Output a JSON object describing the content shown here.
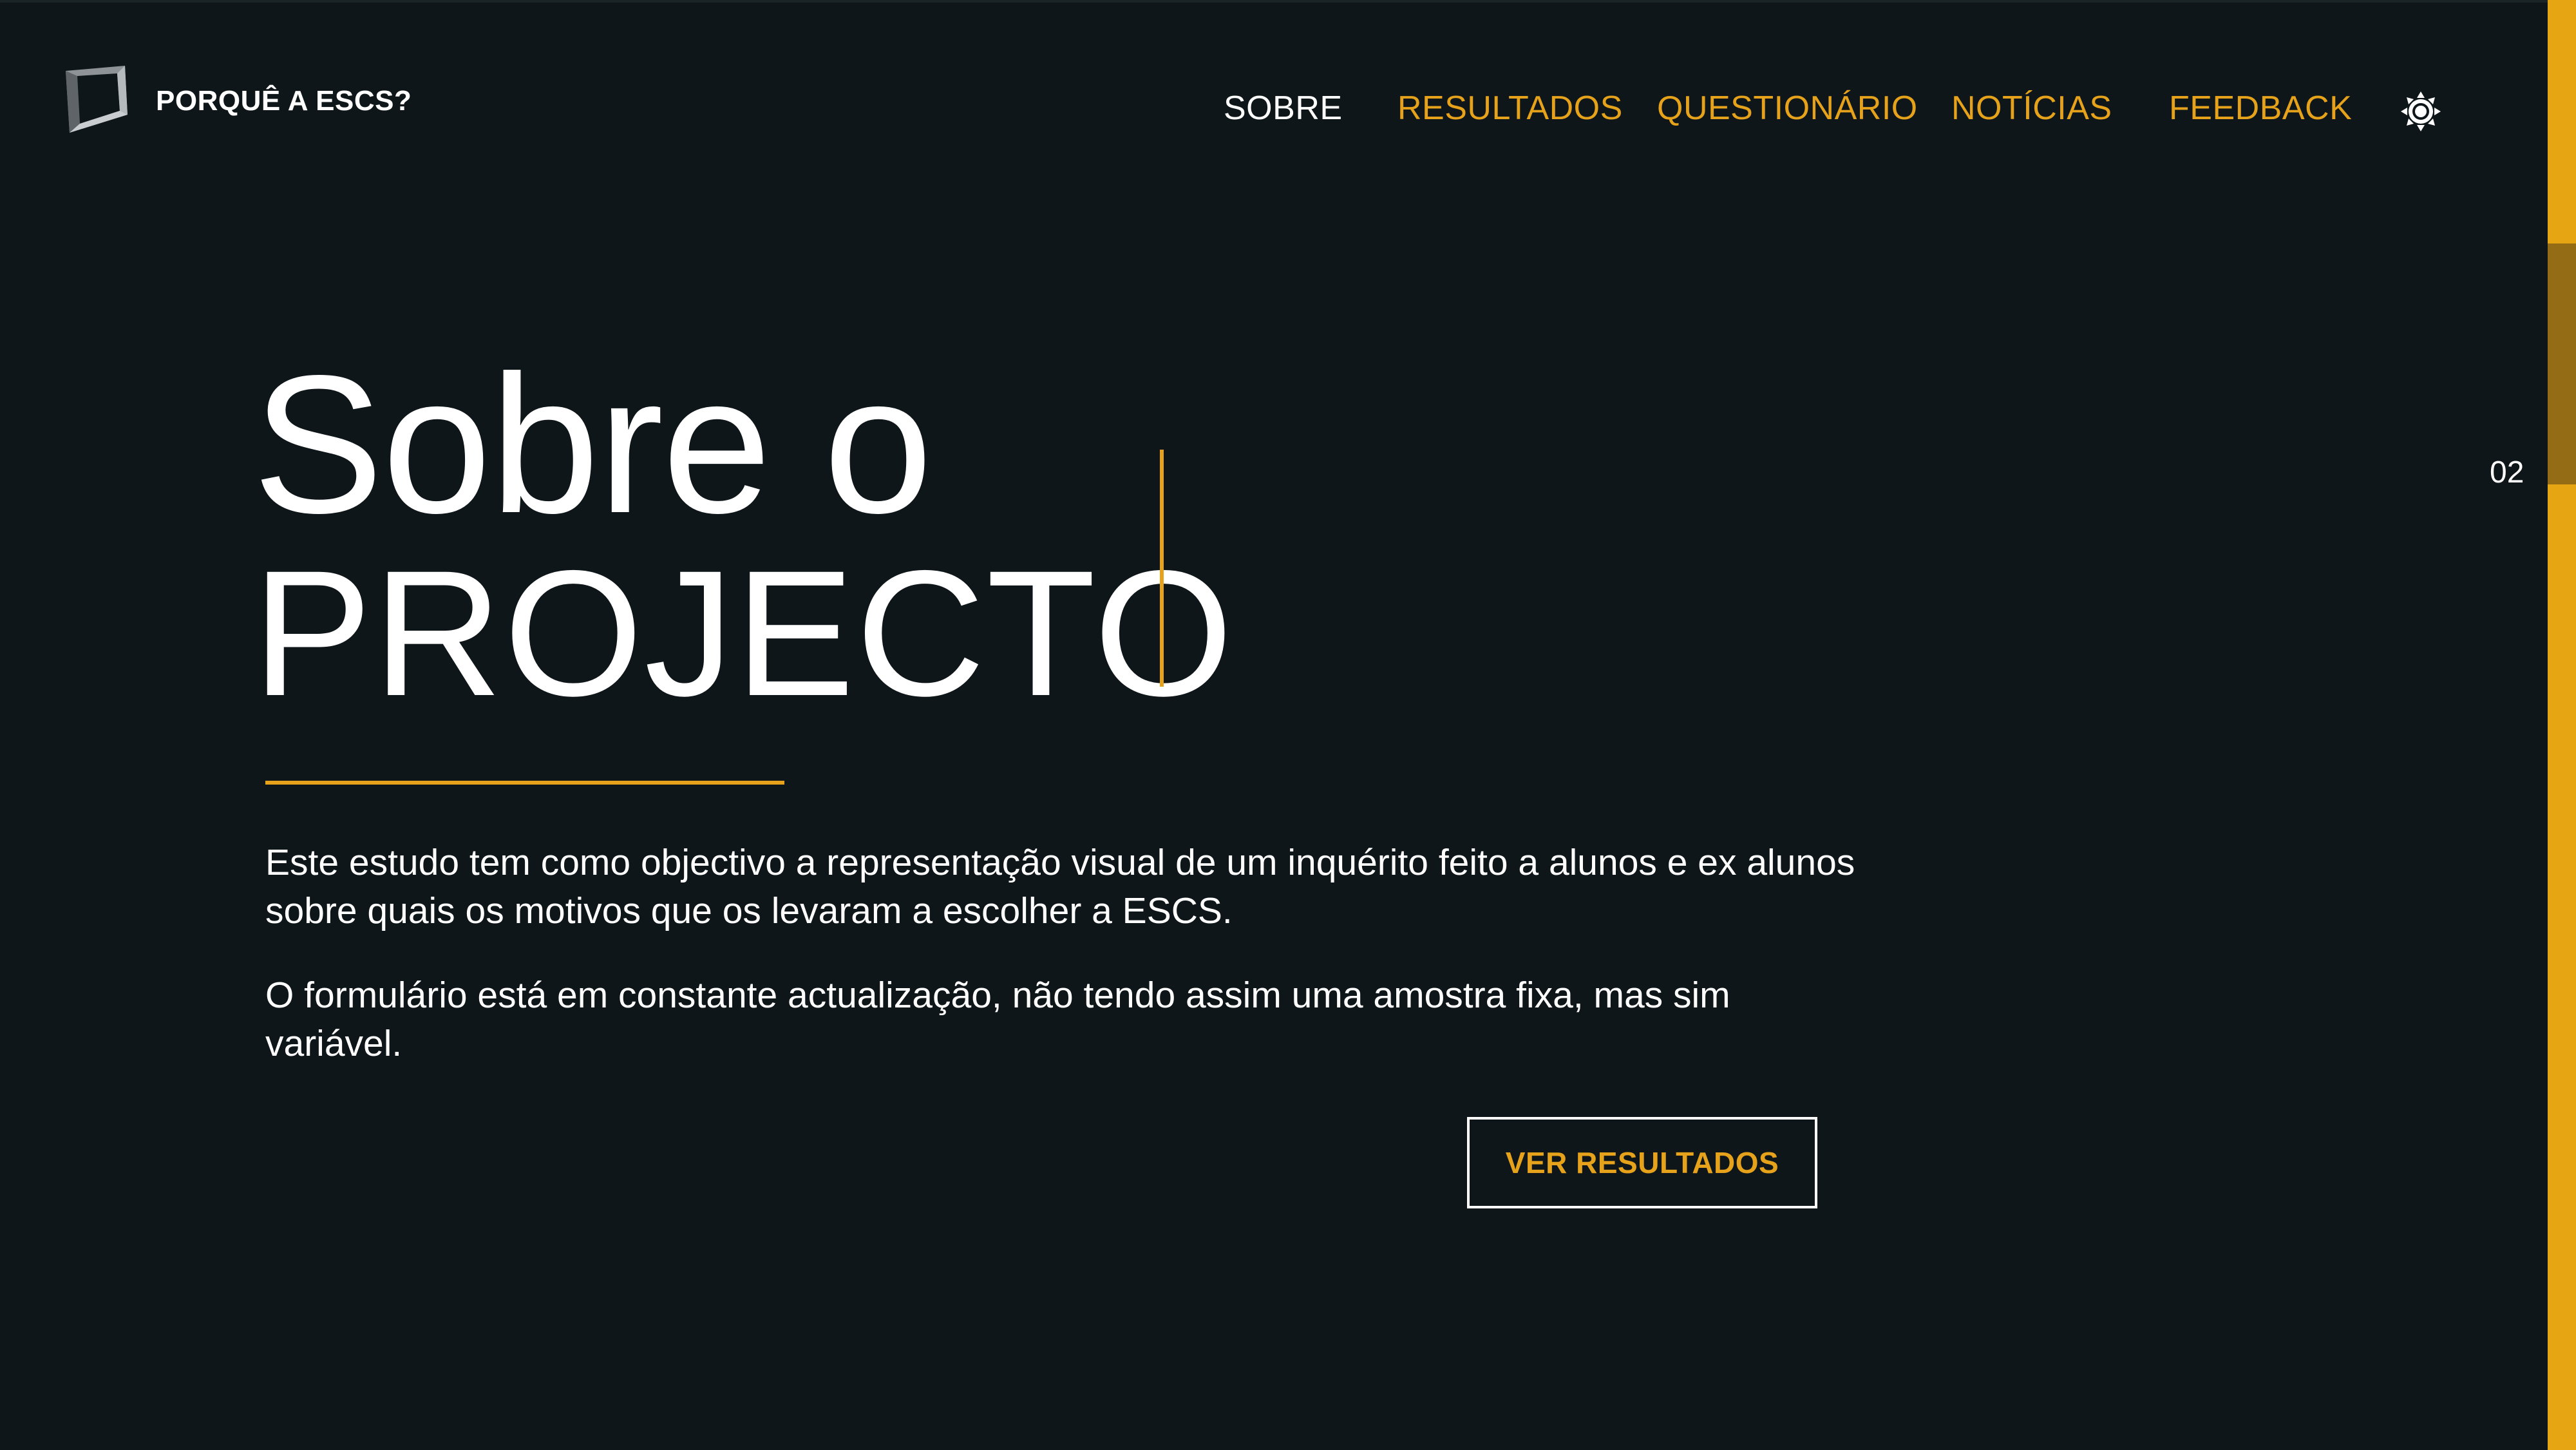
{
  "header": {
    "logo_text": "PORQUÊ A ESCS?",
    "nav": [
      {
        "label": "SOBRE",
        "active": true
      },
      {
        "label": "RESULTADOS",
        "active": false
      },
      {
        "label": "QUESTIONÁRIO",
        "active": false
      },
      {
        "label": "NOTÍCIAS",
        "active": false
      },
      {
        "label": "FEEDBACK",
        "active": false
      }
    ],
    "theme_toggle_icon": "sun-icon"
  },
  "hero": {
    "title_line1": "Sobre o",
    "title_line2": "PROJECTO",
    "paragraphs": [
      "Este estudo tem como objectivo a representação visual de um inquérito feito a alunos e ex alunos sobre quais os motivos que os levaram a escolher a ESCS.",
      "O formulário está em constante actualização, não tendo assim uma amostra fixa, mas sim variável."
    ],
    "cta_label": "VER RESULTADOS"
  },
  "section_indicator": {
    "number": "02"
  },
  "colors": {
    "background": "#0f1619",
    "accent": "#e5a21a",
    "text": "#ffffff",
    "rail": "#e6a513",
    "rail_thumb": "#946c15"
  }
}
